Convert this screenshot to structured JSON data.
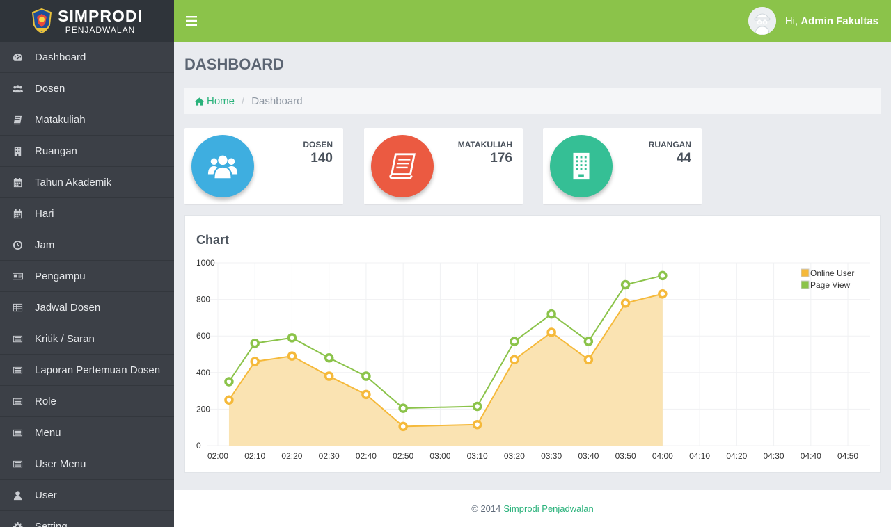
{
  "brand": {
    "title": "SIMPRODI",
    "subtitle": "PENJADWALAN"
  },
  "sidebar": {
    "items": [
      {
        "label": "Dashboard",
        "icon": "dashboard-icon"
      },
      {
        "label": "Dosen",
        "icon": "users-icon"
      },
      {
        "label": "Matakuliah",
        "icon": "book-icon"
      },
      {
        "label": "Ruangan",
        "icon": "building-icon"
      },
      {
        "label": "Tahun Akademik",
        "icon": "calendar-icon"
      },
      {
        "label": "Hari",
        "icon": "calendar-icon"
      },
      {
        "label": "Jam",
        "icon": "clock-icon"
      },
      {
        "label": "Pengampu",
        "icon": "id-card-icon"
      },
      {
        "label": "Jadwal Dosen",
        "icon": "table-icon"
      },
      {
        "label": "Kritik / Saran",
        "icon": "list-icon"
      },
      {
        "label": "Laporan Pertemuan Dosen",
        "icon": "list-icon"
      },
      {
        "label": "Role",
        "icon": "list-icon"
      },
      {
        "label": "Menu",
        "icon": "list-icon"
      },
      {
        "label": "User Menu",
        "icon": "list-icon"
      },
      {
        "label": "User",
        "icon": "user-icon"
      },
      {
        "label": "Setting",
        "icon": "gear-icon"
      }
    ]
  },
  "topbar": {
    "greeting": "Hi, ",
    "username": "Admin Fakultas"
  },
  "page": {
    "title": "DASHBOARD"
  },
  "breadcrumb": {
    "home": "Home",
    "separator": "/",
    "current": "Dashboard"
  },
  "stats": [
    {
      "label": "DOSEN",
      "value": "140",
      "color": "#3eaee0",
      "icon": "users-icon"
    },
    {
      "label": "MATAKULIAH",
      "value": "176",
      "color": "#eb5a41",
      "icon": "book-icon"
    },
    {
      "label": "RUANGAN",
      "value": "44",
      "color": "#35bf95",
      "icon": "building-icon"
    }
  ],
  "chart_panel": {
    "heading": "Chart"
  },
  "chart_data": {
    "type": "area",
    "y_ticks": [
      "0",
      "200",
      "400",
      "600",
      "800",
      "1000"
    ],
    "ylim": [
      0,
      1000
    ],
    "x_ticks": [
      "02:00",
      "02:10",
      "02:20",
      "02:30",
      "02:40",
      "02:50",
      "03:00",
      "03:10",
      "03:20",
      "03:30",
      "03:40",
      "03:50",
      "04:00",
      "04:10",
      "04:20",
      "04:30",
      "04:40",
      "04:50"
    ],
    "x_points": [
      "02:03",
      "02:10",
      "02:20",
      "02:30",
      "02:40",
      "02:50",
      "03:00",
      "03:10",
      "03:20",
      "03:30",
      "03:40",
      "03:50",
      "04:00",
      "04:10"
    ],
    "grid": true,
    "legend_position": "top-right",
    "series": [
      {
        "name": "Online User",
        "color": "#f5b93a",
        "fill": "#fae3b2",
        "values": [
          250,
          460,
          490,
          380,
          280,
          105,
          115,
          470,
          620,
          470,
          780,
          830
        ]
      },
      {
        "name": "Page View",
        "color": "#8bc34a",
        "values": [
          350,
          560,
          590,
          480,
          380,
          205,
          215,
          570,
          720,
          570,
          880,
          930
        ]
      }
    ],
    "x_data": [
      "02:03",
      "02:10",
      "02:20",
      "02:30",
      "02:40",
      "02:50",
      "03:10",
      "03:20",
      "03:30",
      "03:40",
      "03:50",
      "04:00"
    ]
  },
  "footer": {
    "copyright": "© 2014",
    "link": "Simprodi Penjadwalan"
  }
}
